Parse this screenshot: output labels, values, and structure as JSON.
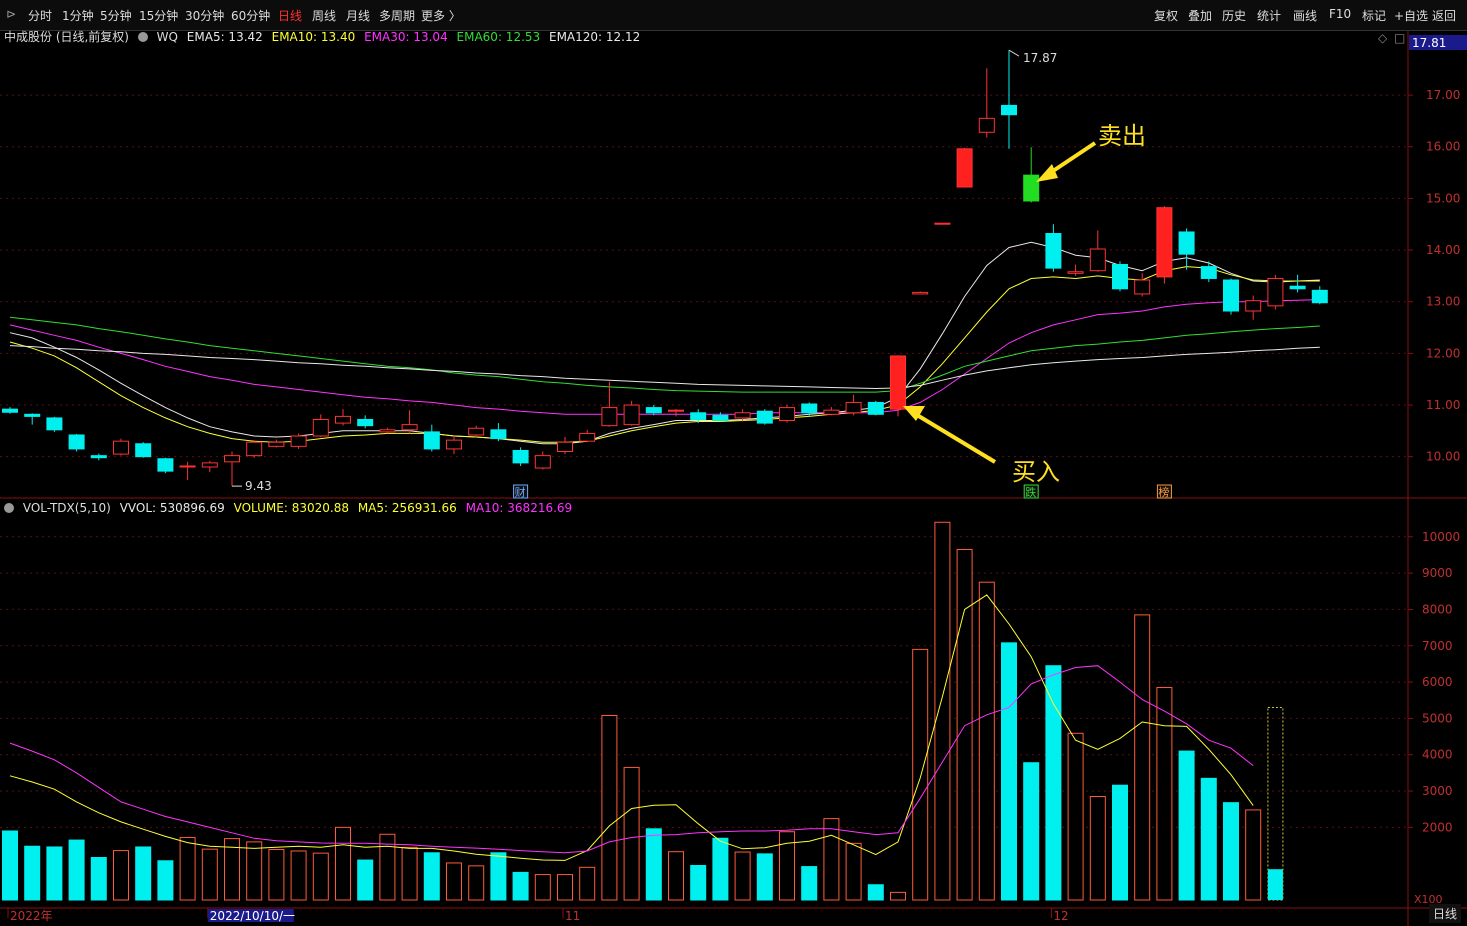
{
  "toolbar": {
    "left_items": [
      "分时",
      "1分钟",
      "5分钟",
      "15分钟",
      "30分钟",
      "60分钟",
      "日线",
      "周线",
      "月线",
      "多周期",
      "更多 〉"
    ],
    "active": "日线",
    "right_items": [
      "复权",
      "叠加",
      "历史",
      "统计",
      "画线",
      "F10",
      "标记",
      "+自选",
      "返回"
    ]
  },
  "main_header": {
    "stock": "中成股份 (日线,前复权)",
    "code": "WQ",
    "indicators": [
      {
        "label": "EMA5: 13.42",
        "color": "#e8e8e8"
      },
      {
        "label": "EMA10: 13.40",
        "color": "#ffff33"
      },
      {
        "label": "EMA30: 13.04",
        "color": "#ff33ff"
      },
      {
        "label": "EMA60: 12.53",
        "color": "#33dd33"
      },
      {
        "label": "EMA120: 12.12",
        "color": "#e8e8e8"
      }
    ],
    "last_price": "17.81"
  },
  "vol_header": {
    "name": "VOL-TDX(5,10)",
    "items": [
      {
        "label": "VVOL: 530896.69",
        "color": "#e8e8e8"
      },
      {
        "label": "VOLUME: 83020.88",
        "color": "#ffff33"
      },
      {
        "label": "MA5: 256931.66",
        "color": "#ffff33"
      },
      {
        "label": "MA10: 368216.69",
        "color": "#ff33ff"
      }
    ]
  },
  "annotations": {
    "sell": "卖出",
    "buy": "买入",
    "high": "17.87",
    "low": "9.43",
    "cai": "财",
    "die": "跌",
    "bang": "榜"
  },
  "timeframe": "日线",
  "chart_data": {
    "type": "candlestick",
    "price_ylim": [
      9.2,
      17.95
    ],
    "price_ticks": [
      10,
      11,
      12,
      13,
      14,
      15,
      16,
      17
    ],
    "vol_ylim": [
      0,
      10600
    ],
    "vol_ticks": [
      2000,
      3000,
      4000,
      5000,
      6000,
      7000,
      8000,
      9000,
      10000
    ],
    "vol_unit": "X100",
    "x_labels": [
      {
        "i": 0,
        "text": "2022年"
      },
      {
        "i": 9,
        "text": "2022/10/10/一"
      },
      {
        "i": 25,
        "text": "11"
      },
      {
        "i": 47,
        "text": "12"
      }
    ],
    "candles": [
      [
        10.92,
        10.86,
        10.96,
        10.83
      ],
      [
        10.82,
        10.78,
        10.84,
        10.62
      ],
      [
        10.75,
        10.52,
        10.77,
        10.48
      ],
      [
        10.42,
        10.15,
        10.44,
        10.1
      ],
      [
        10.02,
        9.98,
        10.06,
        9.93
      ],
      [
        10.05,
        10.3,
        10.35,
        10.02
      ],
      [
        10.25,
        10.0,
        10.28,
        9.98
      ],
      [
        9.96,
        9.72,
        9.98,
        9.68
      ],
      [
        9.8,
        9.82,
        9.9,
        9.55
      ],
      [
        9.8,
        9.88,
        9.92,
        9.7
      ],
      [
        9.9,
        10.02,
        10.1,
        9.43
      ],
      [
        10.02,
        10.28,
        10.32,
        9.98
      ],
      [
        10.2,
        10.28,
        10.33,
        10.18
      ],
      [
        10.2,
        10.4,
        10.45,
        10.15
      ],
      [
        10.4,
        10.72,
        10.82,
        10.38
      ],
      [
        10.65,
        10.78,
        10.92,
        10.6
      ],
      [
        10.72,
        10.6,
        10.8,
        10.55
      ],
      [
        10.48,
        10.52,
        10.56,
        10.45
      ],
      [
        10.52,
        10.62,
        10.9,
        10.45
      ],
      [
        10.48,
        10.15,
        10.62,
        10.1
      ],
      [
        10.15,
        10.32,
        10.4,
        10.05
      ],
      [
        10.42,
        10.55,
        10.6,
        10.38
      ],
      [
        10.52,
        10.35,
        10.65,
        10.3
      ],
      [
        10.12,
        9.88,
        10.18,
        9.82
      ],
      [
        9.78,
        10.02,
        10.1,
        9.75
      ],
      [
        10.1,
        10.28,
        10.38,
        10.05
      ],
      [
        10.3,
        10.45,
        10.52,
        10.28
      ],
      [
        10.6,
        10.95,
        11.45,
        10.58
      ],
      [
        10.62,
        11.0,
        11.08,
        10.6
      ],
      [
        10.95,
        10.85,
        11.0,
        10.8
      ],
      [
        10.88,
        10.9,
        10.92,
        10.78
      ],
      [
        10.85,
        10.72,
        10.92,
        10.65
      ],
      [
        10.8,
        10.7,
        10.86,
        10.68
      ],
      [
        10.75,
        10.85,
        10.92,
        10.68
      ],
      [
        10.88,
        10.65,
        10.92,
        10.62
      ],
      [
        10.7,
        10.95,
        11.0,
        10.66
      ],
      [
        11.02,
        10.85,
        11.05,
        10.78
      ],
      [
        10.82,
        10.9,
        10.96,
        10.8
      ],
      [
        10.85,
        11.05,
        11.2,
        10.8
      ],
      [
        11.05,
        10.82,
        11.08,
        10.8
      ],
      [
        10.92,
        11.95,
        11.96,
        10.78
      ],
      [
        13.15,
        13.18,
        13.2,
        13.15
      ],
      [
        14.5,
        14.52,
        14.52,
        14.5
      ],
      [
        15.22,
        15.96,
        15.98,
        15.22
      ],
      [
        16.28,
        16.55,
        17.52,
        16.18
      ],
      [
        16.8,
        16.62,
        17.87,
        15.96
      ],
      [
        15.45,
        14.95,
        15.99,
        14.92
      ],
      [
        14.32,
        13.65,
        14.5,
        13.58
      ],
      [
        13.55,
        13.58,
        13.72,
        13.5
      ],
      [
        13.6,
        14.02,
        14.38,
        13.58
      ],
      [
        13.72,
        13.25,
        13.78,
        13.2
      ],
      [
        13.15,
        13.42,
        13.55,
        13.1
      ],
      [
        13.48,
        14.82,
        14.85,
        13.35
      ],
      [
        14.35,
        13.92,
        14.42,
        13.62
      ],
      [
        13.68,
        13.45,
        13.78,
        13.38
      ],
      [
        13.42,
        12.82,
        13.45,
        12.75
      ],
      [
        12.82,
        13.02,
        13.12,
        12.65
      ],
      [
        12.92,
        13.45,
        13.52,
        12.85
      ],
      [
        13.3,
        13.25,
        13.52,
        13.18
      ],
      [
        13.22,
        12.98,
        13.3,
        12.95
      ]
    ],
    "ema_lines": [
      {
        "name": "EMA5",
        "color": "#e8e8e8",
        "values": [
          12.4,
          12.3,
          12.12,
          11.92,
          11.68,
          11.42,
          11.18,
          10.95,
          10.75,
          10.58,
          10.48,
          10.4,
          10.38,
          10.4,
          10.45,
          10.5,
          10.5,
          10.5,
          10.5,
          10.45,
          10.4,
          10.38,
          10.35,
          10.3,
          10.25,
          10.25,
          10.3,
          10.45,
          10.55,
          10.62,
          10.7,
          10.7,
          10.7,
          10.72,
          10.75,
          10.78,
          10.82,
          10.85,
          10.9,
          10.95,
          11.15,
          11.7,
          12.38,
          13.1,
          13.7,
          14.05,
          14.15,
          14.05,
          13.9,
          13.85,
          13.7,
          13.6,
          13.78,
          13.85,
          13.75,
          13.55,
          13.4,
          13.38,
          13.4,
          13.42
        ]
      },
      {
        "name": "EMA10",
        "color": "#ffff33",
        "values": [
          12.22,
          12.1,
          11.95,
          11.72,
          11.45,
          11.18,
          10.95,
          10.75,
          10.58,
          10.45,
          10.35,
          10.3,
          10.28,
          10.3,
          10.35,
          10.4,
          10.42,
          10.45,
          10.45,
          10.45,
          10.4,
          10.38,
          10.35,
          10.32,
          10.28,
          10.28,
          10.3,
          10.4,
          10.5,
          10.58,
          10.65,
          10.68,
          10.68,
          10.7,
          10.72,
          10.75,
          10.78,
          10.82,
          10.85,
          10.9,
          11.0,
          11.35,
          11.8,
          12.3,
          12.8,
          13.25,
          13.45,
          13.48,
          13.45,
          13.5,
          13.45,
          13.42,
          13.6,
          13.68,
          13.65,
          13.52,
          13.42,
          13.4,
          13.4,
          13.4
        ]
      },
      {
        "name": "EMA30",
        "color": "#ff33ff",
        "values": [
          12.55,
          12.45,
          12.35,
          12.25,
          12.12,
          12.0,
          11.88,
          11.75,
          11.65,
          11.55,
          11.48,
          11.4,
          11.35,
          11.3,
          11.25,
          11.2,
          11.15,
          11.12,
          11.08,
          11.05,
          11.0,
          10.95,
          10.92,
          10.88,
          10.85,
          10.82,
          10.82,
          10.82,
          10.82,
          10.82,
          10.82,
          10.82,
          10.82,
          10.82,
          10.85,
          10.85,
          10.85,
          10.85,
          10.85,
          10.85,
          10.9,
          11.05,
          11.3,
          11.6,
          11.9,
          12.2,
          12.4,
          12.55,
          12.65,
          12.75,
          12.78,
          12.82,
          12.9,
          12.95,
          12.98,
          13.0,
          13.0,
          13.02,
          13.03,
          13.04
        ]
      },
      {
        "name": "EMA60",
        "color": "#33dd33",
        "values": [
          12.7,
          12.65,
          12.6,
          12.55,
          12.48,
          12.42,
          12.35,
          12.28,
          12.22,
          12.15,
          12.1,
          12.05,
          12.0,
          11.95,
          11.9,
          11.85,
          11.8,
          11.75,
          11.72,
          11.68,
          11.62,
          11.58,
          11.55,
          11.5,
          11.45,
          11.42,
          11.38,
          11.35,
          11.33,
          11.3,
          11.28,
          11.27,
          11.26,
          11.25,
          11.25,
          11.25,
          11.25,
          11.25,
          11.25,
          11.25,
          11.28,
          11.42,
          11.58,
          11.75,
          11.85,
          11.95,
          12.05,
          12.1,
          12.15,
          12.18,
          12.22,
          12.25,
          12.3,
          12.35,
          12.38,
          12.42,
          12.45,
          12.48,
          12.5,
          12.53
        ]
      },
      {
        "name": "EMA120",
        "color": "#e8e8e8",
        "values": [
          12.15,
          12.13,
          12.1,
          12.08,
          12.05,
          12.03,
          12.0,
          11.98,
          11.95,
          11.92,
          11.9,
          11.88,
          11.85,
          11.82,
          11.8,
          11.77,
          11.75,
          11.72,
          11.7,
          11.67,
          11.65,
          11.62,
          11.6,
          11.57,
          11.55,
          11.52,
          11.5,
          11.48,
          11.46,
          11.44,
          11.42,
          11.4,
          11.39,
          11.38,
          11.37,
          11.36,
          11.35,
          11.34,
          11.33,
          11.32,
          11.33,
          11.38,
          11.48,
          11.58,
          11.66,
          11.72,
          11.78,
          11.82,
          11.85,
          11.88,
          11.9,
          11.92,
          11.95,
          11.98,
          12.0,
          12.02,
          12.05,
          12.07,
          12.1,
          12.12
        ]
      }
    ],
    "volume": [
      1900,
      1480,
      1460,
      1650,
      1170,
      1360,
      1460,
      1080,
      1720,
      1400,
      1690,
      1600,
      1390,
      1350,
      1290,
      2000,
      1100,
      1810,
      1450,
      1300,
      1020,
      940,
      1300,
      760,
      700,
      700,
      900,
      5080,
      3650,
      1960,
      1330,
      950,
      1700,
      1320,
      1270,
      1880,
      920,
      2240,
      1560,
      420,
      210,
      6900,
      10400,
      9650,
      8750,
      7080,
      3780,
      6450,
      4590,
      2850,
      3160,
      7850,
      5850,
      4100,
      3350,
      2680,
      2480,
      5300
    ],
    "volume_hollow_last": true,
    "ma5": [
      3420,
      3250,
      3050,
      2700,
      2400,
      2150,
      1950,
      1750,
      1580,
      1480,
      1450,
      1420,
      1450,
      1480,
      1450,
      1520,
      1450,
      1480,
      1420,
      1420,
      1350,
      1260,
      1210,
      1150,
      1100,
      1090,
      1360,
      2040,
      2520,
      2610,
      2620,
      2100,
      1620,
      1410,
      1440,
      1560,
      1620,
      1780,
      1520,
      1250,
      1600,
      3360,
      5600,
      8000,
      8400,
      7600,
      6700,
      5400,
      4400,
      4150,
      4450,
      4900,
      4800,
      4780,
      4150,
      3450,
      2600
    ],
    "ma10": [
      4320,
      4100,
      3860,
      3500,
      3100,
      2700,
      2500,
      2300,
      2150,
      2000,
      1850,
      1700,
      1630,
      1600,
      1570,
      1560,
      1560,
      1540,
      1520,
      1480,
      1450,
      1430,
      1400,
      1360,
      1330,
      1300,
      1350,
      1600,
      1720,
      1780,
      1800,
      1850,
      1880,
      1900,
      1900,
      1920,
      1960,
      1960,
      1880,
      1800,
      1850,
      2800,
      3800,
      4800,
      5100,
      5300,
      5950,
      6200,
      6400,
      6450,
      6000,
      5520,
      5200,
      4850,
      4400,
      4180,
      3700
    ]
  }
}
